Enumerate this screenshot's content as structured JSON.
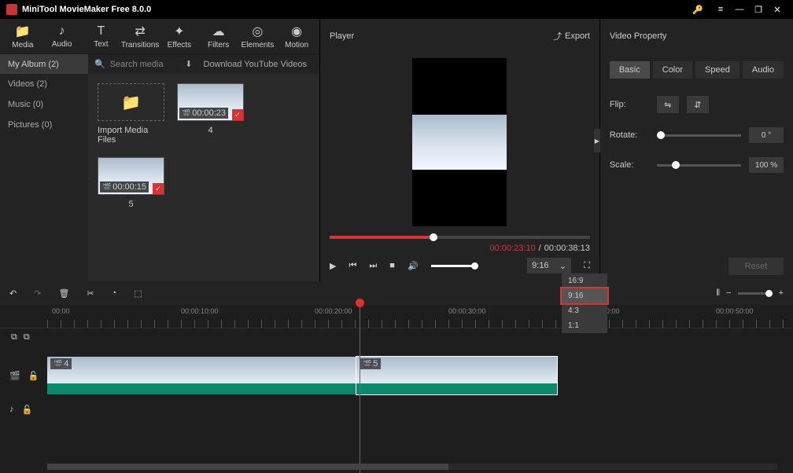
{
  "titlebar": {
    "title": "MiniTool MovieMaker Free 8.0.0"
  },
  "toolbar": [
    {
      "label": "Media",
      "active": true,
      "icon": "folder"
    },
    {
      "label": "Audio",
      "active": false,
      "icon": "music"
    },
    {
      "label": "Text",
      "active": false,
      "icon": "text"
    },
    {
      "label": "Transitions",
      "active": false,
      "icon": "trans"
    },
    {
      "label": "Effects",
      "active": false,
      "icon": "fx"
    },
    {
      "label": "Filters",
      "active": false,
      "icon": "filter"
    },
    {
      "label": "Elements",
      "active": false,
      "icon": "elem"
    },
    {
      "label": "Motion",
      "active": false,
      "icon": "motion"
    }
  ],
  "album": {
    "label": "My Album (2)",
    "search_ph": "Search media",
    "yt": "Download YouTube Videos"
  },
  "sidebar": [
    {
      "label": "Videos (2)"
    },
    {
      "label": "Music (0)"
    },
    {
      "label": "Pictures (0)"
    }
  ],
  "media": {
    "import_label": "Import Media Files",
    "items": [
      {
        "name": "4",
        "dur": "00:00:23"
      },
      {
        "name": "5",
        "dur": "00:00:15"
      }
    ]
  },
  "player": {
    "title": "Player",
    "export": "Export",
    "cur": "00:00:23:10",
    "total": "00:00:38:13",
    "aspect_selected": "9:16",
    "aspect_options": [
      "16:9",
      "9:16",
      "4:3",
      "1:1"
    ]
  },
  "props": {
    "title": "Video Property",
    "tabs": [
      "Basic",
      "Color",
      "Speed",
      "Audio"
    ],
    "active_tab": "Basic",
    "flip": "Flip:",
    "rotate": "Rotate:",
    "rotate_val": "0 °",
    "scale": "Scale:",
    "scale_val": "100 %",
    "reset": "Reset"
  },
  "ruler": [
    "00:00",
    "00:00:10:00",
    "00:00:20:00",
    "00:00:30:00",
    "00:00:40:00",
    "00:00:50:00"
  ],
  "clips": [
    {
      "id": "4"
    },
    {
      "id": "5"
    }
  ]
}
